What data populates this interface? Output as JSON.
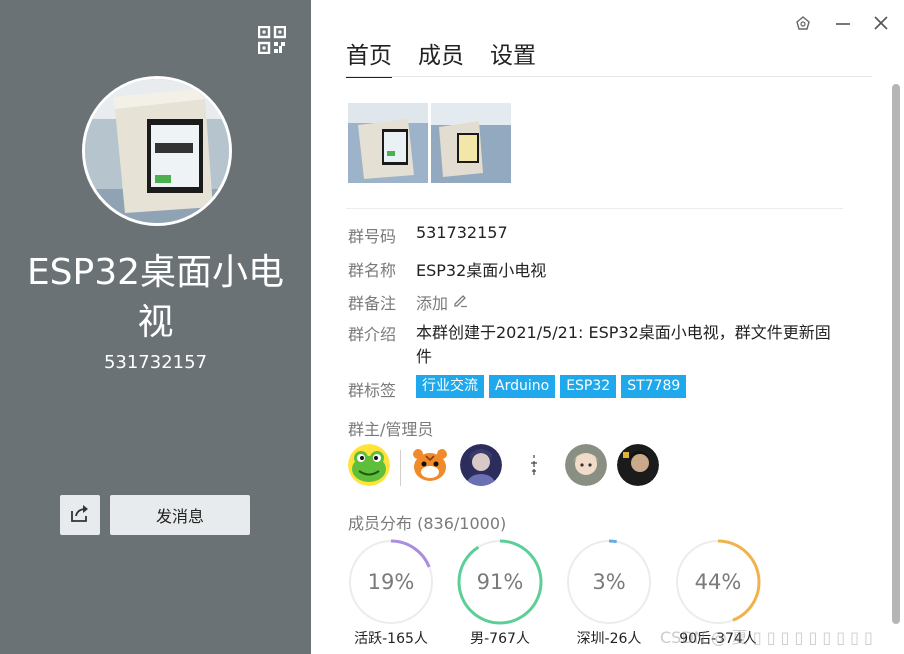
{
  "left": {
    "group_name": "ESP32桌面小电视",
    "group_id": "531732157",
    "send_message_label": "发消息",
    "qr_icon": "qr-code-icon",
    "share_icon": "share-icon",
    "bg_color": "#6a7275"
  },
  "window": {
    "icons": [
      "skin-icon",
      "minimize-icon",
      "close-icon"
    ]
  },
  "tabs": [
    {
      "label": "首页",
      "active": true
    },
    {
      "label": "成员",
      "active": false
    },
    {
      "label": "设置",
      "active": false
    }
  ],
  "info": {
    "id_label": "群号码",
    "id_value": "531732157",
    "name_label": "群名称",
    "name_value": "ESP32桌面小电视",
    "remark_label": "群备注",
    "remark_value": "添加",
    "intro_label": "群介绍",
    "intro_value": "本群创建于2021/5/21: ESP32桌面小电视，群文件更新固件",
    "tags_label": "群标签",
    "tags": [
      "行业交流",
      "Arduino",
      "ESP32",
      "ST7789"
    ],
    "tag_color": "#1fa9ec"
  },
  "admins": {
    "label": "群主/管理员"
  },
  "distribution": {
    "label": "成员分布",
    "count": "(836/1000)",
    "items": [
      {
        "percent": 19,
        "percent_text": "19%",
        "caption": "活跃-165人",
        "color": "#a98ee0"
      },
      {
        "percent": 91,
        "percent_text": "91%",
        "caption": "男-767人",
        "color": "#5ccf98"
      },
      {
        "percent": 3,
        "percent_text": "3%",
        "caption": "深圳-26人",
        "color": "#6aa9e0"
      },
      {
        "percent": 44,
        "percent_text": "44%",
        "caption": "90后-374人",
        "color": "#f2b24b"
      }
    ]
  },
  "watermark": "CSDN @ 夏 ▯ ▯ ▯ ▯ ▯ ▯ ▯ ▯ ▯"
}
